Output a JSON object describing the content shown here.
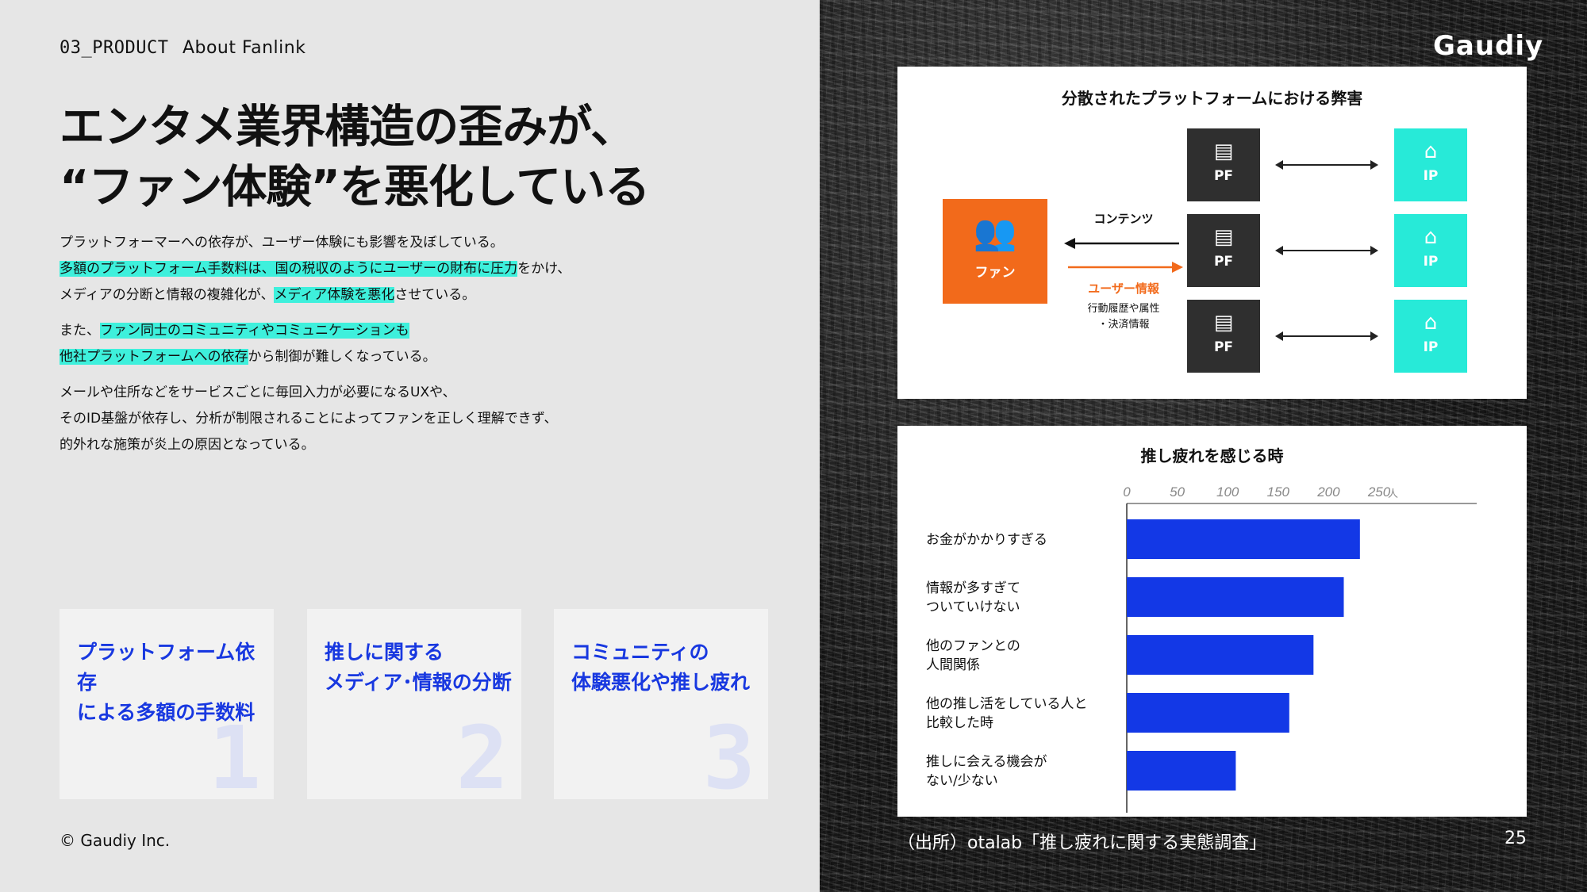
{
  "header": {
    "section_number": "03_PRODUCT",
    "section_label": "About Fanlink"
  },
  "title": {
    "line1": "エンタメ業界構造の歪みが、",
    "line2": "“ファン体験”を悪化している"
  },
  "body": {
    "p1_l1": "プラットフォーマーへの依存が、ユーザー体験にも影響を及ぼしている。",
    "p1_l2_hl": "多額のプラットフォーム手数料は、国の税収のようにユーザーの財布に圧力",
    "p1_l2_rest": "をかけ、",
    "p1_l3_a": "メディアの分断と情報の複雑化が、",
    "p1_l3_hl": "メディア体験を悪化",
    "p1_l3_b": "させている。",
    "p2_l1_a": "また、",
    "p2_l1_hl": "ファン同士のコミュニティやコミュニケーションも",
    "p2_l2_hl": "他社プラットフォームへの依存",
    "p2_l2_rest": "から制御が難しくなっている。",
    "p3_l1": "メールや住所などをサービスごとに毎回入力が必要になるUXや、",
    "p3_l2": "そのID基盤が依存し、分析が制限されることによってファンを正しく理解できず、",
    "p3_l3": "的外れな施策が炎上の原因となっている。"
  },
  "cards": [
    {
      "line1": "プラットフォーム依存",
      "line2": "による多額の手数料",
      "number": "1"
    },
    {
      "line1": "推しに関する",
      "line2": "メディア･情報の分断",
      "number": "2"
    },
    {
      "line1": "コミュニティの",
      "line2": "体験悪化や推し疲れ",
      "number": "3"
    }
  ],
  "footer": {
    "copyright": "© Gaudiy Inc.",
    "source": "（出所）otalab「推し疲れに関する実態調査」",
    "page": "25"
  },
  "logo": "Gaudiy",
  "diagram": {
    "title": "分散されたプラットフォームにおける弊害",
    "fan_label": "ファン",
    "pf_label": "PF",
    "ip_label": "IP",
    "contents_label": "コンテンツ",
    "user_info_label": "ユーザー情報",
    "user_info_sub1": "行動履歴や属性",
    "user_info_sub2": "・決済情報",
    "accent_orange": "#f26a1b",
    "accent_teal": "#27ead8"
  },
  "chart_data": {
    "type": "bar",
    "orientation": "horizontal",
    "title": "推し疲れを感じる時",
    "unit": "人",
    "xlim": [
      0,
      250
    ],
    "ticks": [
      "0",
      "50",
      "100",
      "150",
      "200",
      "250"
    ],
    "categories": [
      [
        "お金がかかりすぎる"
      ],
      [
        "情報が多すぎて",
        "ついていけない"
      ],
      [
        "他のファンとの",
        "人間関係"
      ],
      [
        "他の推し活をしている人と",
        "比較した時"
      ],
      [
        "推しに会える機会が",
        "ない/少ない"
      ]
    ],
    "values": [
      231,
      215,
      185,
      161,
      108
    ],
    "bar_color": "#1338e6"
  }
}
